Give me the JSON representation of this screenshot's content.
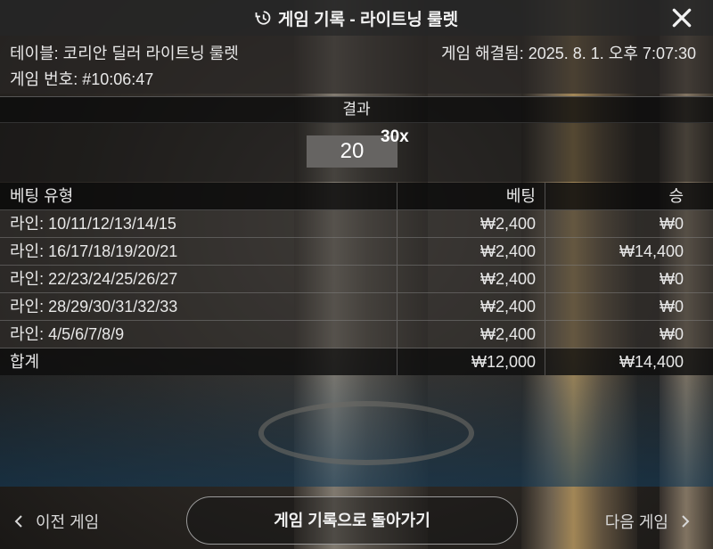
{
  "header": {
    "title": "게임 기록 - 라이트닝 룰렛",
    "history_icon": "history-clock-icon",
    "close_icon": "close-icon"
  },
  "info": {
    "table": "테이블: 코리안 딜러 라이트닝 룰렛",
    "game_number": "게임 번호: #10:06:47",
    "resolved": "게임 해결됨: 2025. 8. 1. 오후 7:07:30"
  },
  "result": {
    "label": "결과",
    "number": "20",
    "multiplier": "30x"
  },
  "bets": {
    "headers": {
      "type": "베팅 유형",
      "bet": "베팅",
      "win": "승"
    },
    "rows": [
      {
        "type": "라인: 10/11/12/13/14/15",
        "bet": "₩2,400",
        "win": "₩0"
      },
      {
        "type": "라인: 16/17/18/19/20/21",
        "bet": "₩2,400",
        "win": "₩14,400"
      },
      {
        "type": "라인: 22/23/24/25/26/27",
        "bet": "₩2,400",
        "win": "₩0"
      },
      {
        "type": "라인: 28/29/30/31/32/33",
        "bet": "₩2,400",
        "win": "₩0"
      },
      {
        "type": "라인: 4/5/6/7/8/9",
        "bet": "₩2,400",
        "win": "₩0"
      }
    ],
    "total": {
      "label": "합계",
      "bet": "₩12,000",
      "win": "₩14,400"
    }
  },
  "footer": {
    "prev": "이전 게임",
    "back": "게임 기록으로 돌아가기",
    "next": "다음 게임"
  }
}
